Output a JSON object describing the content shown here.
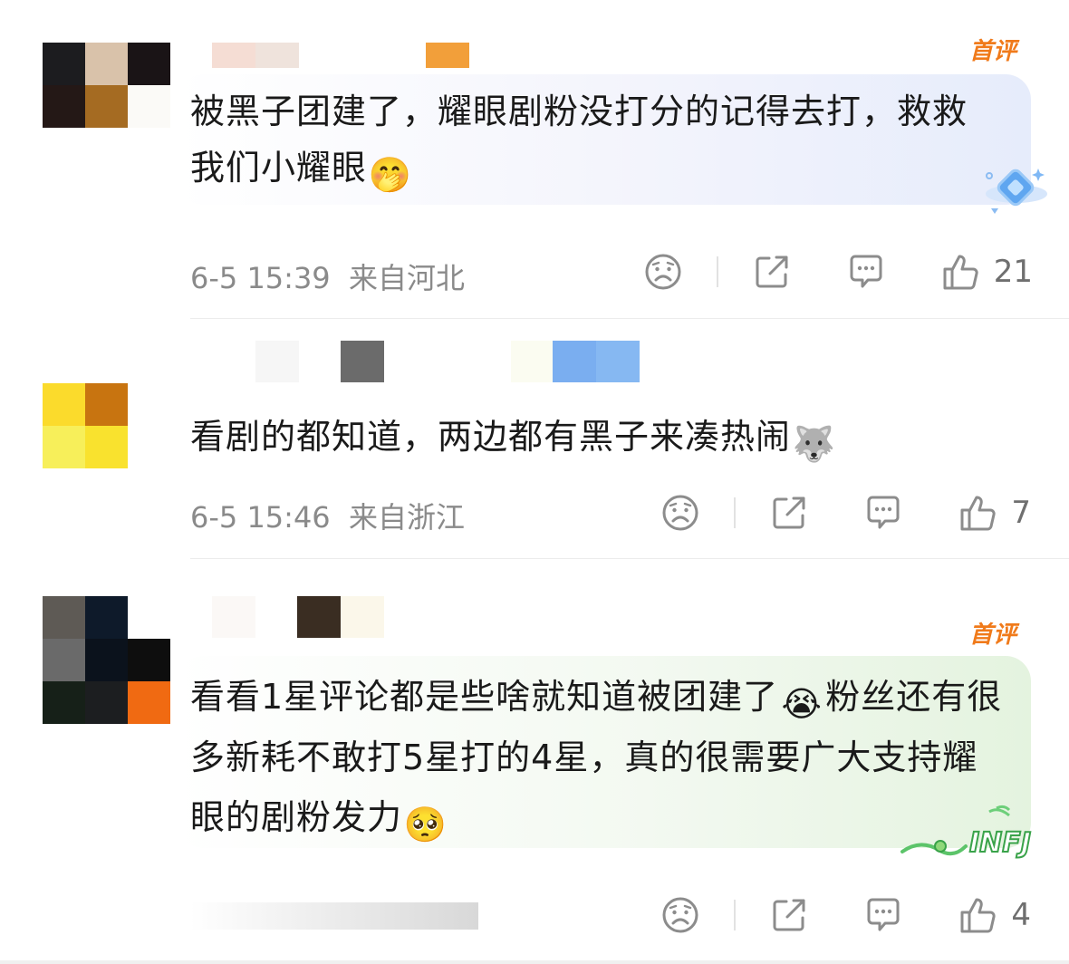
{
  "comments": [
    {
      "badge": "首评",
      "text": "被黑子团建了，耀眼剧粉没打分的记得去打，救救我们小耀眼",
      "emoji": "🤭",
      "time": "6-5 15:39",
      "location": "来自河北",
      "likes": "21"
    },
    {
      "badge": "",
      "text": "看剧的都知道，两边都有黑子来凑热闹",
      "emoji": "🐺",
      "time": "6-5 15:46",
      "location": "来自浙江",
      "likes": "7"
    },
    {
      "badge": "首评",
      "text": "看看1星评论都是些啥就知道被团建了",
      "emoji": "😭",
      "text_after": "粉丝还有很多新耗不敢打5星打的4星，真的很需要广大支持耀眼的剧粉发力",
      "emoji_end": "🥺",
      "time": "",
      "location": "",
      "likes": "4"
    }
  ],
  "decorations": {
    "sticker_c1": "diamond-sticker",
    "sticker_c3": "INFJ"
  },
  "colors": {
    "badge": "#f07a1a",
    "meta": "#8a8a8a",
    "icon": "#8c8c8c"
  }
}
